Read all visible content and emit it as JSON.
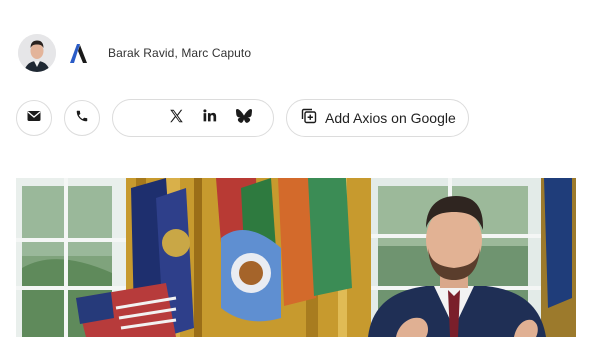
{
  "article": {
    "authors": "Barak Ravid, Marc Caputo"
  },
  "share": {
    "email_icon": "email-icon",
    "phone_icon": "phone-icon",
    "x_icon": "x-icon",
    "linkedin_icon": "linkedin-icon",
    "bluesky_icon": "bluesky-icon",
    "add_google_label": "Add Axios on Google"
  },
  "colors": {
    "text": "#222222",
    "border": "#dcdcdc",
    "axios_blue": "#2a5cc7"
  }
}
